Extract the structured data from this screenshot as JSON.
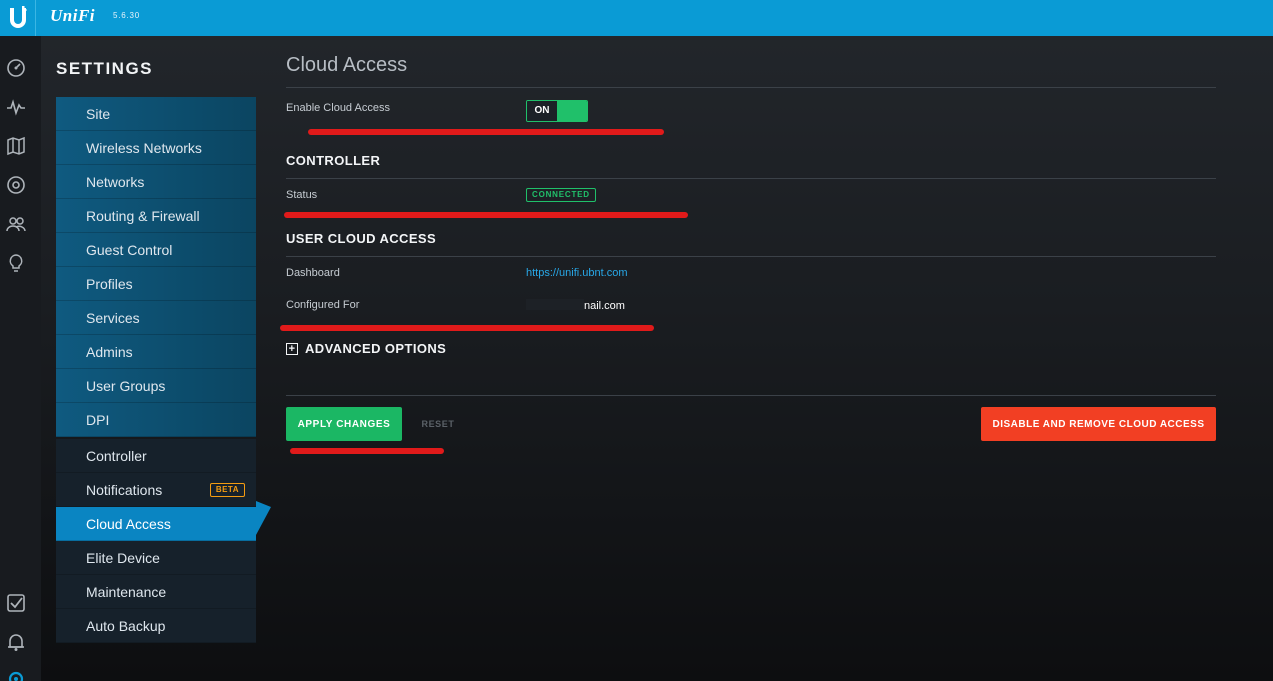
{
  "app": {
    "logo_letter": "U",
    "brand": "UniFi",
    "version": "5.6.30"
  },
  "rail": {
    "icons": [
      "dashboard-icon",
      "statistics-icon",
      "map-icon",
      "devices-icon",
      "clients-icon",
      "insights-icon",
      "events-icon",
      "alerts-icon",
      "settings-icon"
    ]
  },
  "sidebar": {
    "title": "SETTINGS",
    "group1": [
      {
        "label": "Site"
      },
      {
        "label": "Wireless Networks"
      },
      {
        "label": "Networks"
      },
      {
        "label": "Routing & Firewall"
      },
      {
        "label": "Guest Control"
      },
      {
        "label": "Profiles"
      },
      {
        "label": "Services"
      },
      {
        "label": "Admins"
      },
      {
        "label": "User Groups"
      },
      {
        "label": "DPI"
      }
    ],
    "group2": [
      {
        "label": "Controller"
      },
      {
        "label": "Notifications",
        "badge": "BETA"
      },
      {
        "label": "Cloud Access",
        "active": true
      },
      {
        "label": "Elite Device"
      },
      {
        "label": "Maintenance"
      },
      {
        "label": "Auto Backup"
      }
    ]
  },
  "main": {
    "title": "Cloud Access",
    "enable_label": "Enable Cloud Access",
    "toggle_state": "ON",
    "controller_section": "CONTROLLER",
    "status_label": "Status",
    "status_value": "CONNECTED",
    "user_section": "USER CLOUD ACCESS",
    "dashboard_label": "Dashboard",
    "dashboard_link": "https://unifi.ubnt.com",
    "configured_label": "Configured For",
    "configured_value": "nail.com",
    "advanced_label": "ADVANCED OPTIONS",
    "apply_label": "APPLY CHANGES",
    "reset_label": "RESET",
    "disable_label": "DISABLE AND REMOVE CLOUD ACCESS"
  },
  "colors": {
    "topbar": "#0a9bd5",
    "accent_green": "#1bb764",
    "danger": "#f23f23",
    "active_nav": "#0a85c2",
    "annotation_red": "#e01a1a"
  }
}
